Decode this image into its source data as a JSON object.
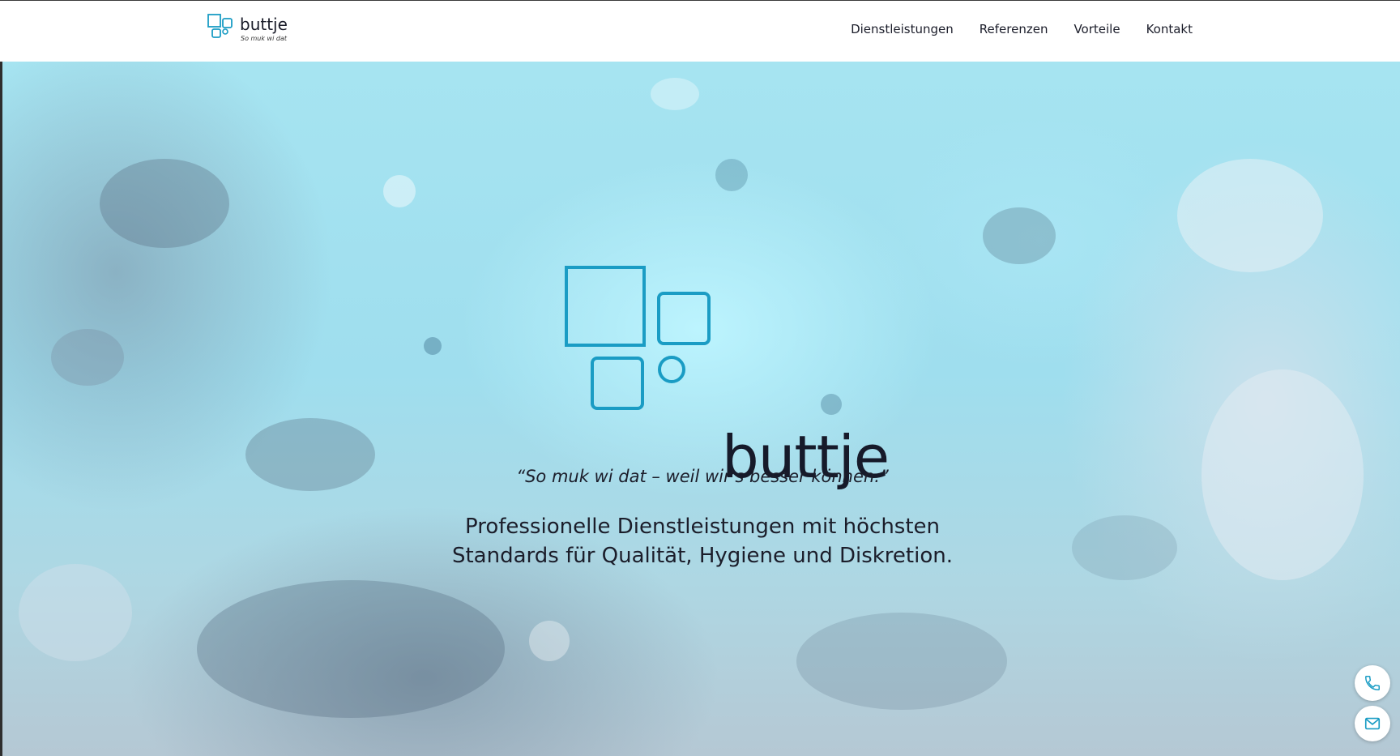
{
  "header": {
    "brand": {
      "name": "buttje",
      "tagline": "So muk wi dat"
    },
    "nav": [
      {
        "label": "Dienstleistungen"
      },
      {
        "label": "Referenzen"
      },
      {
        "label": "Vorteile"
      },
      {
        "label": "Kontakt"
      }
    ]
  },
  "hero": {
    "logo_text": "buttje",
    "slogan": "“So muk wi dat – weil wir's besser können.”",
    "description_line1": "Professionelle Dienstleistungen mit höchsten",
    "description_line2": "Standards für Qualität, Hygiene und Diskretion."
  },
  "floating_actions": [
    {
      "icon": "phone-icon"
    },
    {
      "icon": "mail-icon"
    }
  ],
  "colors": {
    "brand_blue": "#1a9cc4",
    "text_dark": "#1b1d2a"
  }
}
